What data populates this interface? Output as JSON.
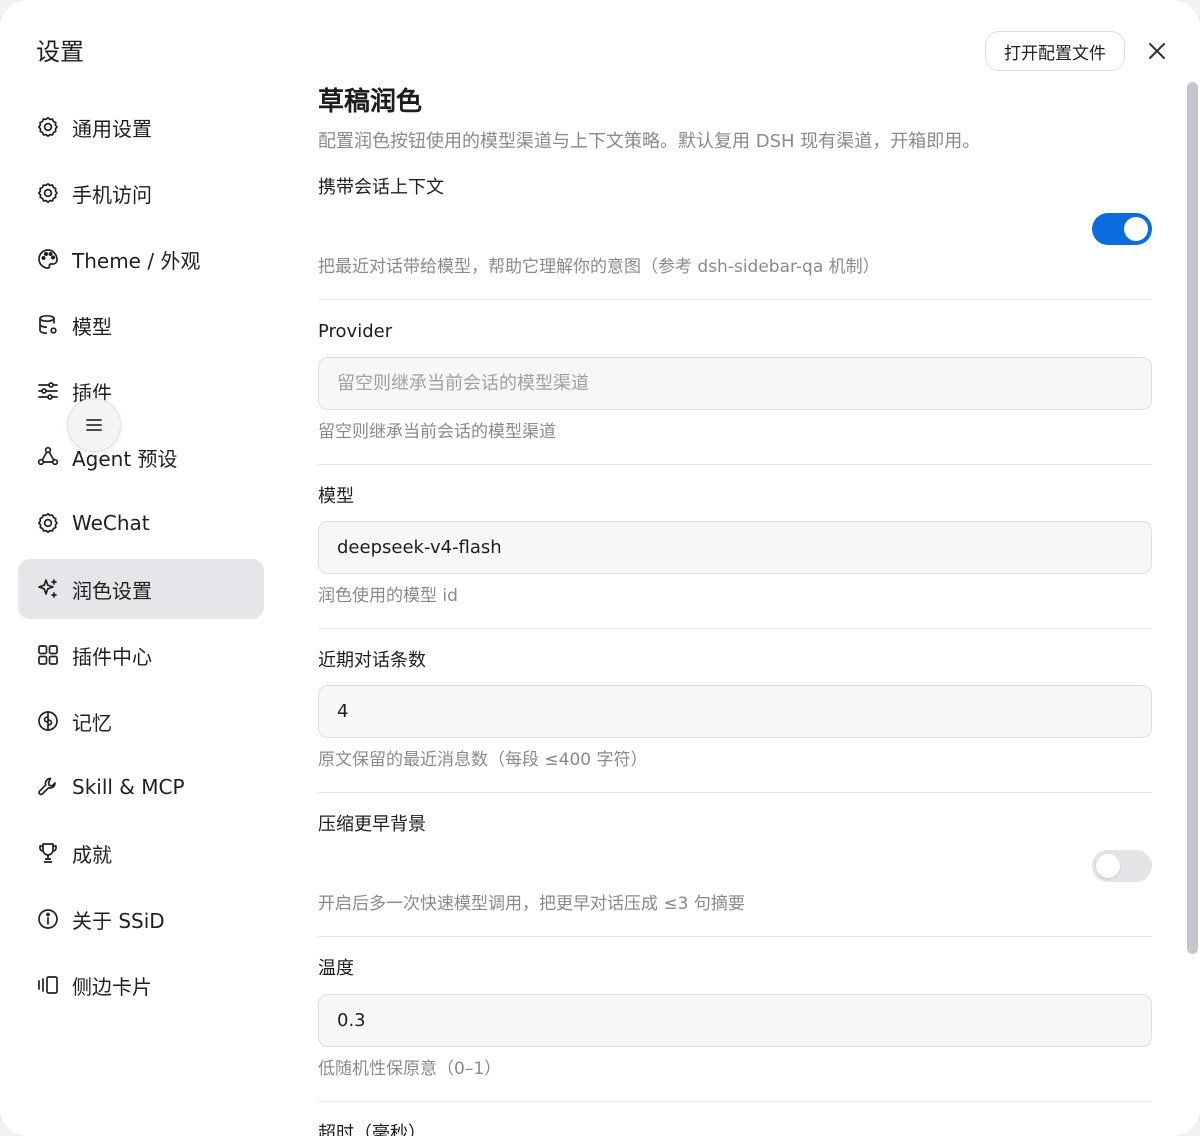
{
  "dialog": {
    "title": "设置",
    "open_config_label": "打开配置文件"
  },
  "sidebar": {
    "items": [
      {
        "label": "通用设置",
        "icon": "gear-icon"
      },
      {
        "label": "手机访问",
        "icon": "gear-icon"
      },
      {
        "label": "Theme / 外观",
        "icon": "palette-icon"
      },
      {
        "label": "模型",
        "icon": "database-icon"
      },
      {
        "label": "插件",
        "icon": "sliders-icon"
      },
      {
        "label": "Agent 预设",
        "icon": "agent-icon"
      },
      {
        "label": "WeChat",
        "icon": "gear-icon"
      },
      {
        "label": "润色设置",
        "icon": "sparkle-icon",
        "active": true
      },
      {
        "label": "插件中心",
        "icon": "grid-icon"
      },
      {
        "label": "记忆",
        "icon": "brain-icon"
      },
      {
        "label": "Skill & MCP",
        "icon": "wrench-icon"
      },
      {
        "label": "成就",
        "icon": "trophy-icon"
      },
      {
        "label": "关于 SSiD",
        "icon": "info-icon"
      },
      {
        "label": "侧边卡片",
        "icon": "side-cards-icon"
      }
    ],
    "floating_menu_icon": "menu-icon"
  },
  "content": {
    "title": "草稿润色",
    "description": "配置润色按钮使用的模型渠道与上下文策略。默认复用 DSH 现有渠道，开箱即用。",
    "carry_context": {
      "label": "携带会话上下文",
      "hint": "把最近对话带给模型，帮助它理解你的意图（参考 dsh-sidebar-qa 机制）",
      "enabled": true
    },
    "provider": {
      "label": "Provider",
      "value": "",
      "placeholder": "留空则继承当前会话的模型渠道",
      "hint": "留空则继承当前会话的模型渠道"
    },
    "model": {
      "label": "模型",
      "value": "deepseek-v4-flash",
      "hint": "润色使用的模型 id"
    },
    "recent_count": {
      "label": "近期对话条数",
      "value": "4",
      "hint": "原文保留的最近消息数（每段 ≤400 字符）"
    },
    "compress": {
      "label": "压缩更早背景",
      "hint": "开启后多一次快速模型调用，把更早对话压成 ≤3 句摘要",
      "enabled": false
    },
    "temperature": {
      "label": "温度",
      "value": "0.3",
      "hint": "低随机性保原意（0–1）"
    },
    "timeout": {
      "label": "超时（毫秒）"
    }
  },
  "colors": {
    "accent": "#0a6cdf",
    "active_nav_bg": "#e5e5ea",
    "hint_text": "#8a8a8e"
  }
}
